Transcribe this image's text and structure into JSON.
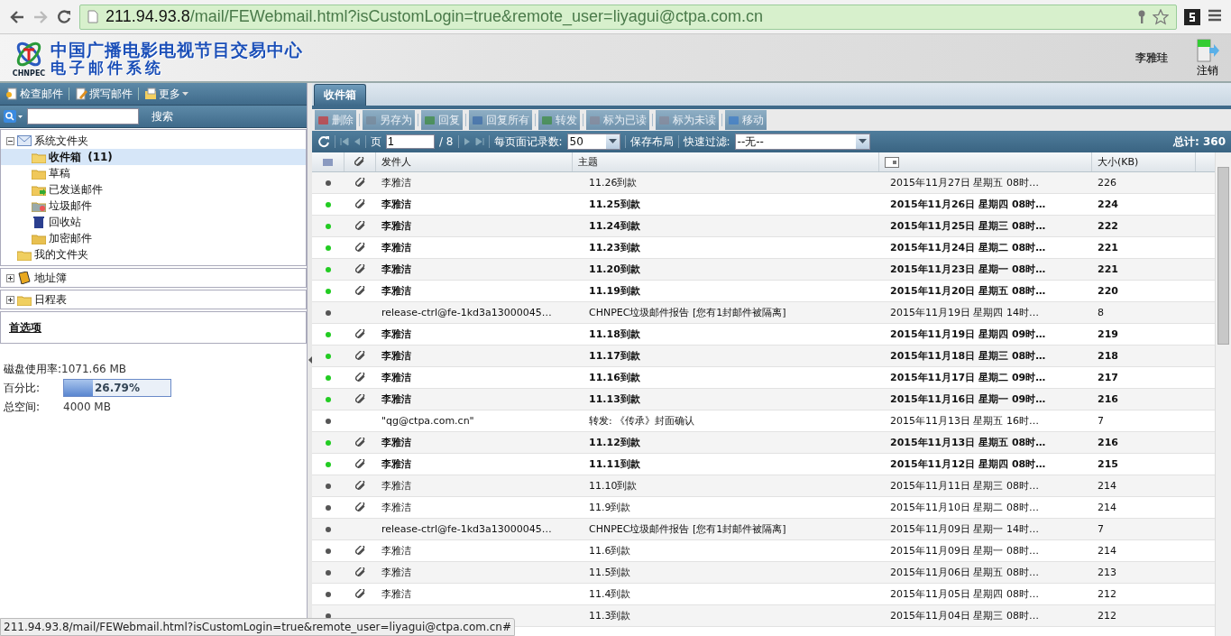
{
  "browser": {
    "url_host": "211.94.93.8",
    "url_path": "/mail/FEWebmail.html?isCustomLogin=true&remote_user=liyagui@ctpa.com.cn"
  },
  "header": {
    "logo_text": "CHNPEC",
    "title": "中国广播电影电视节目交易中心",
    "subtitle": "电子邮件系统",
    "user": "李雅珪",
    "logout": "注销"
  },
  "left_toolbar": [
    {
      "label": "检查邮件",
      "kind": "check"
    },
    {
      "label": "撰写邮件",
      "kind": "compose"
    },
    {
      "label": "更多",
      "kind": "more"
    }
  ],
  "search": {
    "button": "搜索"
  },
  "folders": {
    "label": "系统文件夹",
    "expanded": true,
    "children": [
      {
        "label": "收件箱",
        "count": "(11)",
        "kind": "inbox",
        "selected": true
      },
      {
        "label": "草稿",
        "kind": "drafts",
        "selected": false
      },
      {
        "label": "已发送邮件",
        "kind": "sent",
        "selected": false
      },
      {
        "label": "垃圾邮件",
        "kind": "junk",
        "selected": false
      },
      {
        "label": "回收站",
        "kind": "trash",
        "selected": false
      },
      {
        "label": "加密邮件",
        "kind": "secure",
        "selected": false
      }
    ]
  },
  "my_folders": {
    "label": "我的文件夹"
  },
  "sections": [
    {
      "label": "地址簿",
      "kind": "contacts",
      "expanded": false
    },
    {
      "label": "日程表",
      "kind": "calendar",
      "expanded": false
    }
  ],
  "preferences": "首选项",
  "disk": {
    "usage_label": "磁盘使用率:",
    "usage": "1071.66 MB",
    "percent_label": "百分比:",
    "level": 0.2679,
    "percent": "26.79%",
    "total_label": "总空间:",
    "total": "4000 MB"
  },
  "tab": "收件箱",
  "actions": [
    {
      "label": "删除",
      "kind": "delete",
      "disabled": true
    },
    {
      "label": "另存为",
      "kind": "save",
      "disabled": true
    },
    {
      "label": "回复",
      "kind": "reply",
      "disabled": true
    },
    {
      "label": "回复所有",
      "kind": "replyall",
      "disabled": true
    },
    {
      "label": "转发",
      "kind": "forward",
      "disabled": true
    },
    {
      "label": "标为已读",
      "kind": "read",
      "disabled": true
    },
    {
      "label": "标为未读",
      "kind": "unread",
      "disabled": true
    },
    {
      "label": "移动",
      "kind": "move",
      "disabled": true
    }
  ],
  "pager": {
    "page_label": "页",
    "page": "1",
    "pages": "/ 8",
    "per_page_label": "每页面记录数:",
    "per_page": "50",
    "save_layout": "保存布局",
    "filter_label": "快速过滤:",
    "filter": "--无--",
    "total": "总计: 360"
  },
  "columns": {
    "sender": "发件人",
    "subject": "主题",
    "size": "大小(KB)"
  },
  "rows": [
    {
      "unread": false,
      "attachment": true,
      "sender": "李雅洁",
      "subject": "11.26到款",
      "date": "2015年11月27日 星期五 08时…",
      "size": "226"
    },
    {
      "unread": true,
      "attachment": true,
      "sender": "李雅洁",
      "subject": "11.25到款",
      "date": "2015年11月26日 星期四 08时…",
      "size": "224"
    },
    {
      "unread": true,
      "attachment": true,
      "sender": "李雅洁",
      "subject": "11.24到款",
      "date": "2015年11月25日 星期三 08时…",
      "size": "222"
    },
    {
      "unread": true,
      "attachment": true,
      "sender": "李雅洁",
      "subject": "11.23到款",
      "date": "2015年11月24日 星期二 08时…",
      "size": "221"
    },
    {
      "unread": true,
      "attachment": true,
      "sender": "李雅洁",
      "subject": "11.20到款",
      "date": "2015年11月23日 星期一 08时…",
      "size": "221"
    },
    {
      "unread": true,
      "attachment": true,
      "sender": "李雅洁",
      "subject": "11.19到款",
      "date": "2015年11月20日 星期五 08时…",
      "size": "220"
    },
    {
      "unread": false,
      "attachment": false,
      "sender": "release-ctrl@fe-1kd3a13000045…",
      "subject": "CHNPEC垃圾邮件报告 [您有1封邮件被隔离]",
      "date": "2015年11月19日 星期四 14时…",
      "size": "8"
    },
    {
      "unread": true,
      "attachment": true,
      "sender": "李雅洁",
      "subject": "11.18到款",
      "date": "2015年11月19日 星期四 09时…",
      "size": "219"
    },
    {
      "unread": true,
      "attachment": true,
      "sender": "李雅洁",
      "subject": "11.17到款",
      "date": "2015年11月18日 星期三 08时…",
      "size": "218"
    },
    {
      "unread": true,
      "attachment": true,
      "sender": "李雅洁",
      "subject": "11.16到款",
      "date": "2015年11月17日 星期二 09时…",
      "size": "217"
    },
    {
      "unread": true,
      "attachment": true,
      "sender": "李雅洁",
      "subject": "11.13到款",
      "date": "2015年11月16日 星期一 09时…",
      "size": "216"
    },
    {
      "unread": false,
      "attachment": false,
      "sender": "\"qg@ctpa.com.cn\"",
      "subject": "转发: 《传承》封面确认",
      "date": "2015年11月13日 星期五 16时…",
      "size": "7"
    },
    {
      "unread": true,
      "attachment": true,
      "sender": "李雅洁",
      "subject": "11.12到款",
      "date": "2015年11月13日 星期五 08时…",
      "size": "216"
    },
    {
      "unread": true,
      "attachment": true,
      "sender": "李雅洁",
      "subject": "11.11到款",
      "date": "2015年11月12日 星期四 08时…",
      "size": "215"
    },
    {
      "unread": false,
      "attachment": true,
      "sender": "李雅洁",
      "subject": "11.10到款",
      "date": "2015年11月11日 星期三 08时…",
      "size": "214"
    },
    {
      "unread": false,
      "attachment": true,
      "sender": "李雅洁",
      "subject": "11.9到款",
      "date": "2015年11月10日 星期二 08时…",
      "size": "214"
    },
    {
      "unread": false,
      "attachment": false,
      "sender": "release-ctrl@fe-1kd3a13000045…",
      "subject": "CHNPEC垃圾邮件报告 [您有1封邮件被隔离]",
      "date": "2015年11月09日 星期一 14时…",
      "size": "7"
    },
    {
      "unread": false,
      "attachment": true,
      "sender": "李雅洁",
      "subject": "11.6到款",
      "date": "2015年11月09日 星期一 08时…",
      "size": "214"
    },
    {
      "unread": false,
      "attachment": true,
      "sender": "李雅洁",
      "subject": "11.5到款",
      "date": "2015年11月06日 星期五 08时…",
      "size": "213"
    },
    {
      "unread": false,
      "attachment": true,
      "sender": "李雅洁",
      "subject": "11.4到款",
      "date": "2015年11月05日 星期四 08时…",
      "size": "212"
    },
    {
      "unread": false,
      "subject": "11.3到款",
      "date": "2015年11月04日 星期三 08时…",
      "size": "212"
    }
  ],
  "status_bar": "211.94.93.8/mail/FEWebmail.html?isCustomLogin=true&remote_user=liyagui@ctpa.com.cn#"
}
